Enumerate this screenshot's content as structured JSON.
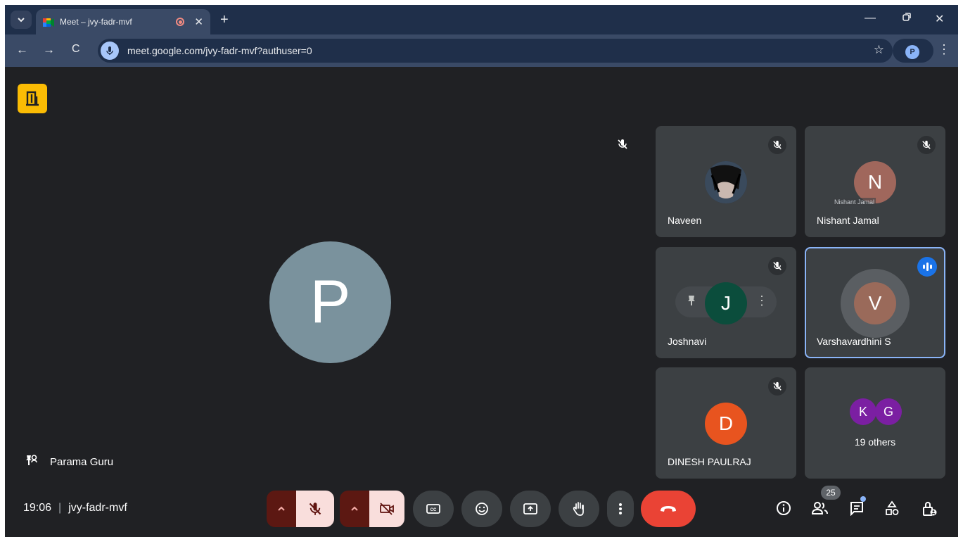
{
  "browser": {
    "tab_title": "Meet – jvy-fadr-mvf",
    "url": "meet.google.com/jvy-fadr-mvf?authuser=0",
    "profile_initial": "P"
  },
  "meeting": {
    "badge_icon": "door-icon",
    "main_speaker": {
      "initial": "P",
      "name": "Parama Guru"
    },
    "time": "19:06",
    "separator": "|",
    "code": "jvy-fadr-mvf",
    "participant_count": "25"
  },
  "tiles": [
    {
      "name": "Naveen",
      "initial": "",
      "avatar_color": "#2b2f3a",
      "muted": true
    },
    {
      "name": "Nishant Jamal",
      "initial": "N",
      "avatar_color": "#a0675c",
      "muted": true,
      "tooltip": "Nishant Jamal"
    },
    {
      "name": "Joshnavi",
      "initial": "J",
      "avatar_color": "#0b4d3c",
      "muted": true
    },
    {
      "name": "Varshavardhini S",
      "initial": "V",
      "avatar_color": "#9a6a5a",
      "speaking": true
    },
    {
      "name": "DINESH PAULRAJ",
      "initial": "D",
      "avatar_color": "#e8541f",
      "muted": true
    },
    {
      "name": "19 others",
      "initials": [
        "K",
        "G"
      ],
      "avatar_color": "#7b1fa2"
    }
  ],
  "colors": {
    "meet_bg": "#202124",
    "tile_bg": "#3c4043",
    "end_call": "#ea4335",
    "active_border": "#8ab4f8"
  }
}
